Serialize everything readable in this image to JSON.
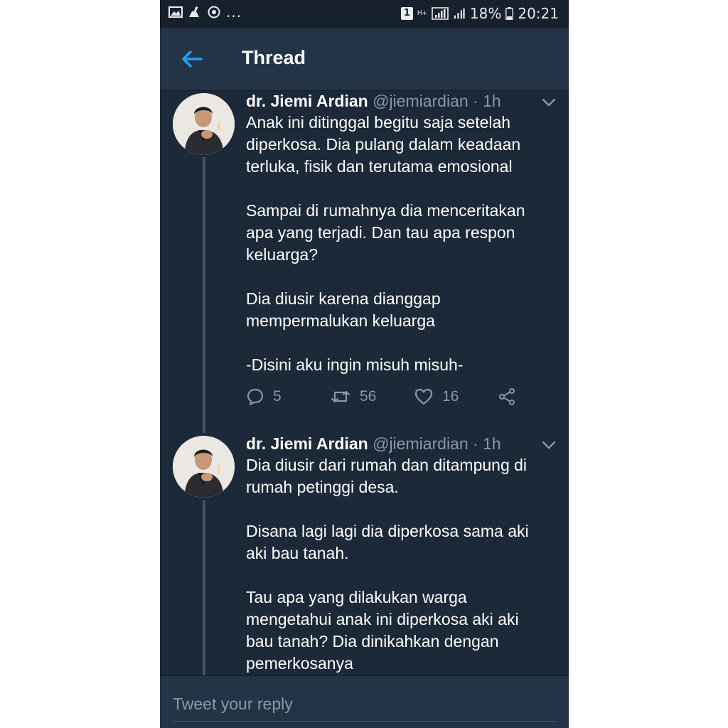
{
  "status_bar": {
    "icons": [
      "gallery-icon",
      "cleaner-icon",
      "sync-icon"
    ],
    "more": "...",
    "sim": "1",
    "network": "H+",
    "battery": "18%",
    "time": "20:21"
  },
  "header": {
    "back_icon": "arrow-left-icon",
    "title": "Thread"
  },
  "tweets": [
    {
      "author": "dr. Jiemi Ardian",
      "handle": "@jiemiardian",
      "separator": "·",
      "time": "1h",
      "text": "Anak ini ditinggal begitu saja setelah\ndiperkosa. Dia pulang dalam keadaan\nterluka, fisik dan terutama emosional\n\nSampai di rumahnya dia menceritakan\napa yang terjadi. Dan tau apa respon\nkeluarga?\n\nDia diusir karena dianggap\nmempermalukan keluarga\n\n-Disini aku ingin misuh misuh-",
      "replies": "5",
      "retweets": "56",
      "likes": "16"
    },
    {
      "author": "dr. Jiemi Ardian",
      "handle": "@jiemiardian",
      "separator": "·",
      "time": "1h",
      "text": "Dia diusir dari rumah dan ditampung di\nrumah petinggi desa.\n\nDisana lagi lagi dia diperkosa sama aki\naki bau tanah.\n\nTau apa yang dilakukan warga\nmengetahui anak ini diperkosa aki aki\nbau tanah? Dia dinikahkan dengan\npemerkosanya"
    }
  ],
  "reply": {
    "placeholder": "Tweet your reply"
  },
  "colors": {
    "background": "#1c2938",
    "header": "#243447",
    "muted_text": "#8899a6",
    "accent": "#1da1f2"
  }
}
